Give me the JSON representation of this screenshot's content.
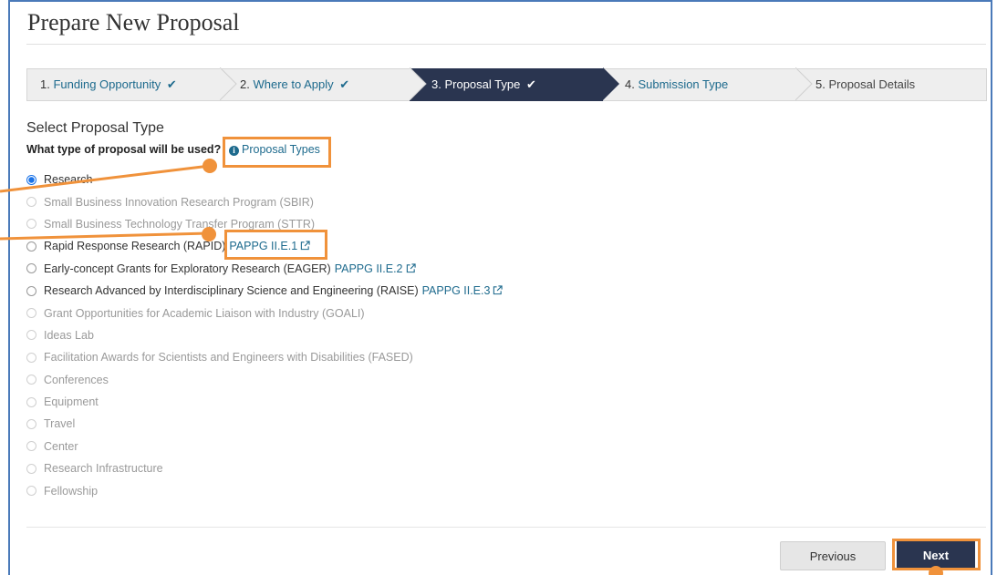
{
  "page": {
    "title": "Prepare New Proposal"
  },
  "steps": [
    {
      "num": "1.",
      "label": "Funding Opportunity",
      "done": true
    },
    {
      "num": "2.",
      "label": "Where to Apply",
      "done": true
    },
    {
      "num": "3.",
      "label": "Proposal Type",
      "done": true,
      "active": true
    },
    {
      "num": "4.",
      "label": "Submission Type",
      "done": false
    },
    {
      "num": "5.",
      "label": "Proposal Details",
      "done": false
    }
  ],
  "check_glyph": "✔",
  "section": {
    "title": "Select Proposal Type",
    "question": "What type of proposal will be used?",
    "types_link": "Proposal Types"
  },
  "options": [
    {
      "label": "Research",
      "state": "checked"
    },
    {
      "label": "Small Business Innovation Research Program (SBIR)",
      "state": "disabled"
    },
    {
      "label": "Small Business Technology Transfer Program (STTR)",
      "state": "disabled"
    },
    {
      "label": "Rapid Response Research (RAPID)",
      "state": "enabled",
      "link": "PAPPG II.E.1"
    },
    {
      "label": "Early-concept Grants for Exploratory Research (EAGER)",
      "state": "enabled",
      "link": "PAPPG II.E.2"
    },
    {
      "label": "Research Advanced by Interdisciplinary Science and Engineering (RAISE)",
      "state": "enabled",
      "link": "PAPPG II.E.3"
    },
    {
      "label": "Grant Opportunities for Academic Liaison with Industry (GOALI)",
      "state": "disabled"
    },
    {
      "label": "Ideas Lab",
      "state": "disabled"
    },
    {
      "label": "Facilitation Awards for Scientists and Engineers with Disabilities (FASED)",
      "state": "disabled"
    },
    {
      "label": "Conferences",
      "state": "disabled"
    },
    {
      "label": "Equipment",
      "state": "disabled"
    },
    {
      "label": "Travel",
      "state": "disabled"
    },
    {
      "label": "Center",
      "state": "disabled"
    },
    {
      "label": "Research Infrastructure",
      "state": "disabled"
    },
    {
      "label": "Fellowship",
      "state": "disabled"
    }
  ],
  "buttons": {
    "previous": "Previous",
    "next": "Next"
  },
  "colors": {
    "accent_dark": "#2a3550",
    "link": "#1d6a8d",
    "annotation": "#f0923b",
    "radio_selected": "#1a73e8"
  }
}
